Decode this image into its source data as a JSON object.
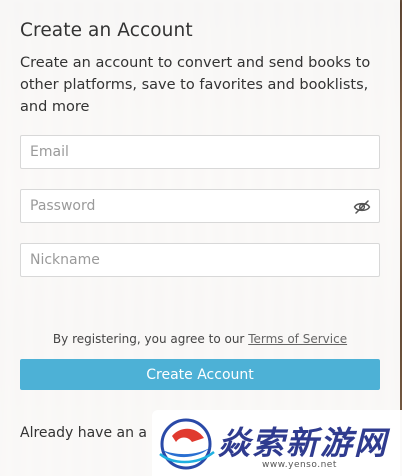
{
  "modal": {
    "title": "Create an Account",
    "description": "Create an account to convert and send books to other platforms, save to favorites and booklists, and more"
  },
  "form": {
    "email_placeholder": "Email",
    "password_placeholder": "Password",
    "nickname_placeholder": "Nickname",
    "password_toggle_icon": "eye-slash-icon",
    "terms_prefix": "By registering, you agree to our ",
    "terms_link": "Terms of Service",
    "submit_label": "Create Account"
  },
  "footer": {
    "login_prefix": "Already have an a"
  },
  "watermark": {
    "brand": "焱索新游网",
    "url": "www.yenso.net"
  },
  "colors": {
    "accent": "#4db1d6",
    "text": "#333333",
    "watermark_text": "#2f3b8f"
  }
}
